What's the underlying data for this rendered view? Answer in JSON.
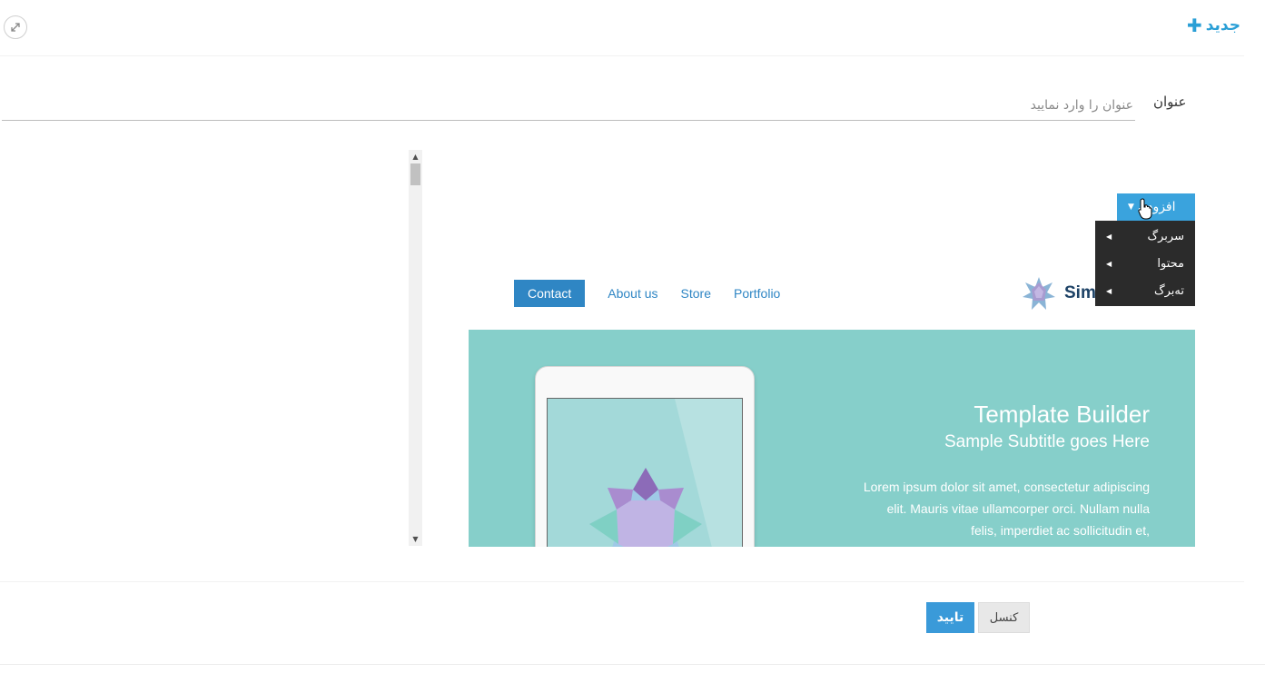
{
  "header": {
    "new_label": "جدید",
    "new_icon": "plus-icon",
    "expand_icon": "expand-icon"
  },
  "form": {
    "title_label": "عنوان",
    "title_placeholder": "عنوان را وارد نمایید",
    "title_value": ""
  },
  "builder": {
    "add_label": "افزودن",
    "add_caret_icon": "caret-down-icon",
    "menu_items": [
      {
        "label": "سربرگ",
        "icon": "caret-left-icon"
      },
      {
        "label": "محتوا",
        "icon": "caret-left-icon"
      },
      {
        "label": "ته‌برگ",
        "icon": "caret-left-icon"
      }
    ]
  },
  "preview": {
    "nav": [
      "Contact",
      "About us",
      "Store",
      "Portfolio"
    ],
    "brand_name": "Sim",
    "hero_title": "Template Builder",
    "hero_subtitle": "Sample Subtitle goes Here",
    "hero_body": "Lorem ipsum dolor sit amet, consectetur adipiscing elit. Mauris vitae ullamcorper orci. Nullam nulla felis, imperdiet ac sollicitudin et,",
    "colors": {
      "hero_bg": "#86cfca",
      "nav_active": "#2f86c4",
      "brand": "#1d4266"
    }
  },
  "footer": {
    "confirm_label": "تایید",
    "cancel_label": "کنسل"
  },
  "colors": {
    "accent": "#2a9fd6",
    "confirm": "#3a9ad9",
    "add_button": "#3aa3dd",
    "menu_bg": "#2b2b2b"
  }
}
